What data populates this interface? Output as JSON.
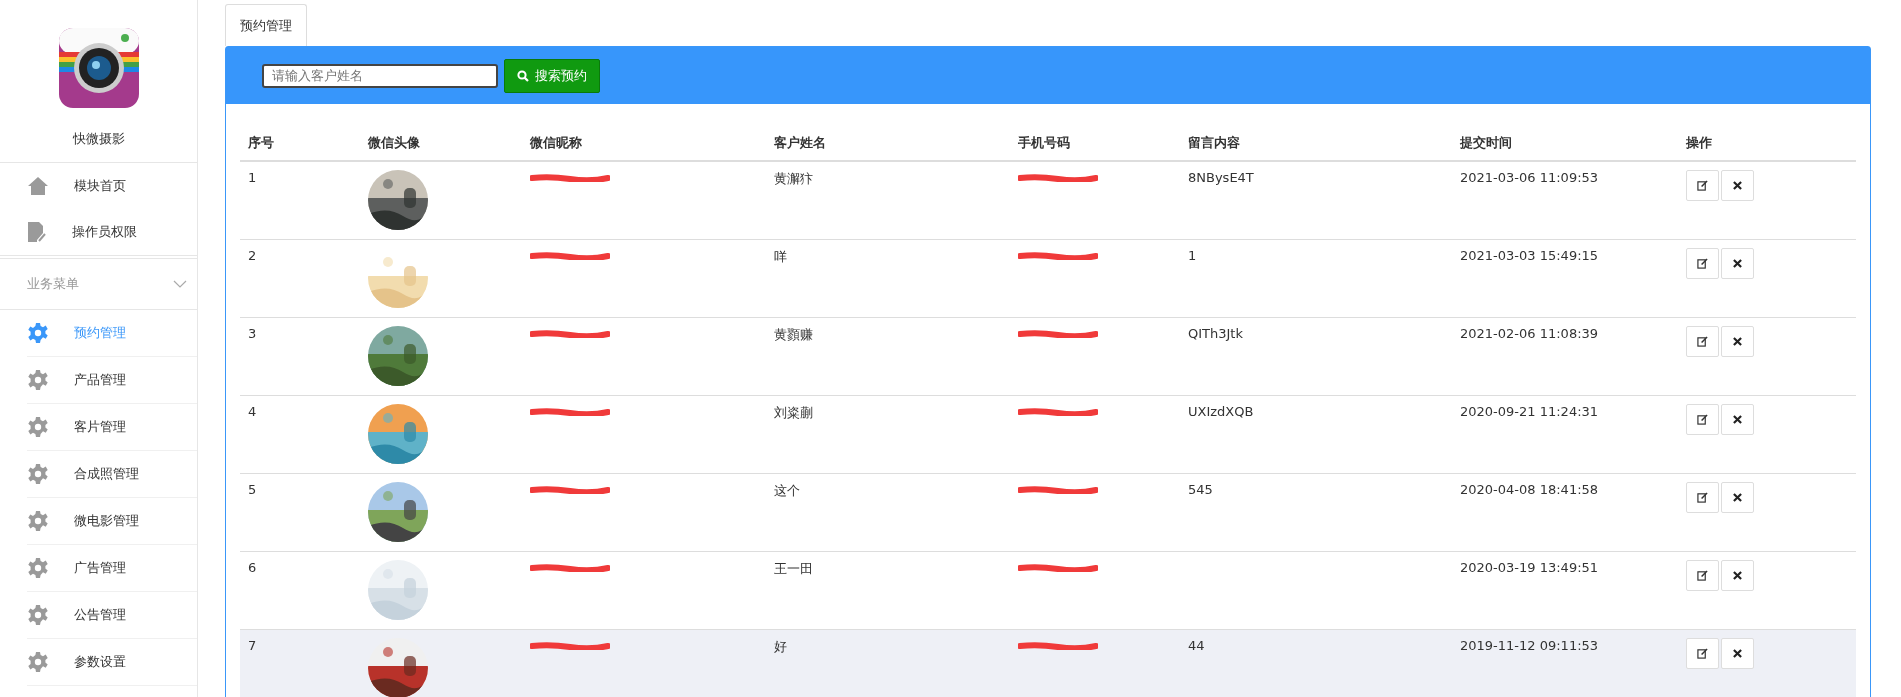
{
  "sidebar": {
    "app_name": "快微摄影",
    "top_items": [
      {
        "label": "模块首页"
      },
      {
        "label": "操作员权限"
      }
    ],
    "section": {
      "label": "业务菜单",
      "expanded": true
    },
    "items": [
      {
        "label": "预约管理",
        "selected": true
      },
      {
        "label": "产品管理",
        "selected": false
      },
      {
        "label": "客片管理",
        "selected": false
      },
      {
        "label": "合成照管理",
        "selected": false
      },
      {
        "label": "微电影管理",
        "selected": false
      },
      {
        "label": "广告管理",
        "selected": false
      },
      {
        "label": "公告管理",
        "selected": false
      },
      {
        "label": "参数设置",
        "selected": false
      }
    ]
  },
  "tabs": [
    {
      "label": "预约管理",
      "selected": true
    }
  ],
  "search": {
    "placeholder": "请输入客户姓名",
    "button": "搜索预约"
  },
  "table": {
    "columns": [
      "序号",
      "微信头像",
      "微信昵称",
      "客户姓名",
      "手机号码",
      "留言内容",
      "提交时间",
      "操作"
    ],
    "rows": [
      {
        "no": "1",
        "nickname_redacted": true,
        "name": "黄澥犿",
        "phone_redacted": true,
        "message": "8NBysE4T",
        "time": "2021-03-06 11:09:53",
        "highlighted": false
      },
      {
        "no": "2",
        "nickname_redacted": true,
        "name": "咩",
        "phone_redacted": true,
        "message": "1",
        "time": "2021-03-03 15:49:15",
        "highlighted": false
      },
      {
        "no": "3",
        "nickname_redacted": true,
        "name": "黄顟赚",
        "phone_redacted": true,
        "message": "QITh3Jtk",
        "time": "2021-02-06 11:08:39",
        "highlighted": false
      },
      {
        "no": "4",
        "nickname_redacted": true,
        "name": "刘粢蒯",
        "phone_redacted": true,
        "message": "UXIzdXQB",
        "time": "2020-09-21 11:24:31",
        "highlighted": false
      },
      {
        "no": "5",
        "nickname_redacted": true,
        "name": "这个",
        "phone_redacted": true,
        "message": "545",
        "time": "2020-04-08 18:41:58",
        "highlighted": false
      },
      {
        "no": "6",
        "nickname_redacted": true,
        "name": "王一田",
        "phone_redacted": true,
        "time": "2020-03-19 13:49:51",
        "highlighted": false
      },
      {
        "no": "7",
        "nickname_redacted": true,
        "name": "好",
        "phone_redacted": true,
        "message": "44",
        "time": "2019-11-12 09:11:53",
        "highlighted": true
      }
    ]
  }
}
